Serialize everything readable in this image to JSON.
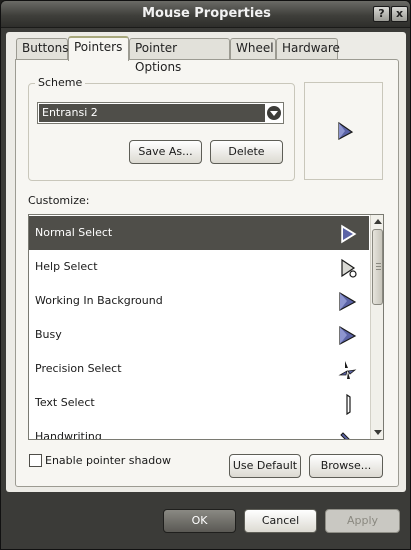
{
  "window": {
    "title": "Mouse Properties",
    "help_glyph": "?",
    "close_glyph": "x"
  },
  "tabs": [
    {
      "label": "Buttons",
      "active": false
    },
    {
      "label": "Pointers",
      "active": true
    },
    {
      "label": "Pointer Options",
      "active": false
    },
    {
      "label": "Wheel",
      "active": false
    },
    {
      "label": "Hardware",
      "active": false
    }
  ],
  "scheme": {
    "group_label": "Scheme",
    "selected_value": "Entransi 2",
    "save_as_label": "Save As...",
    "delete_label": "Delete"
  },
  "customize": {
    "label": "Customize:",
    "items": [
      {
        "label": "Normal Select",
        "icon": "arrow-cursor-icon",
        "selected": true
      },
      {
        "label": "Help Select",
        "icon": "help-cursor-icon",
        "selected": false
      },
      {
        "label": "Working In Background",
        "icon": "working-cursor-icon",
        "selected": false
      },
      {
        "label": "Busy",
        "icon": "busy-cursor-icon",
        "selected": false
      },
      {
        "label": "Precision Select",
        "icon": "precision-cursor-icon",
        "selected": false
      },
      {
        "label": "Text Select",
        "icon": "text-cursor-icon",
        "selected": false
      },
      {
        "label": "Handwriting",
        "icon": "handwriting-cursor-icon",
        "selected": false
      }
    ]
  },
  "pointer_shadow": {
    "label": "Enable pointer shadow",
    "checked": false
  },
  "buttons": {
    "use_default": "Use Default",
    "browse": "Browse...",
    "ok": "OK",
    "cancel": "Cancel",
    "apply": "Apply"
  },
  "colors": {
    "selection": "#4f4e49",
    "window_frame": "#3b3b38",
    "cursor_blue": "#5b63a6"
  }
}
